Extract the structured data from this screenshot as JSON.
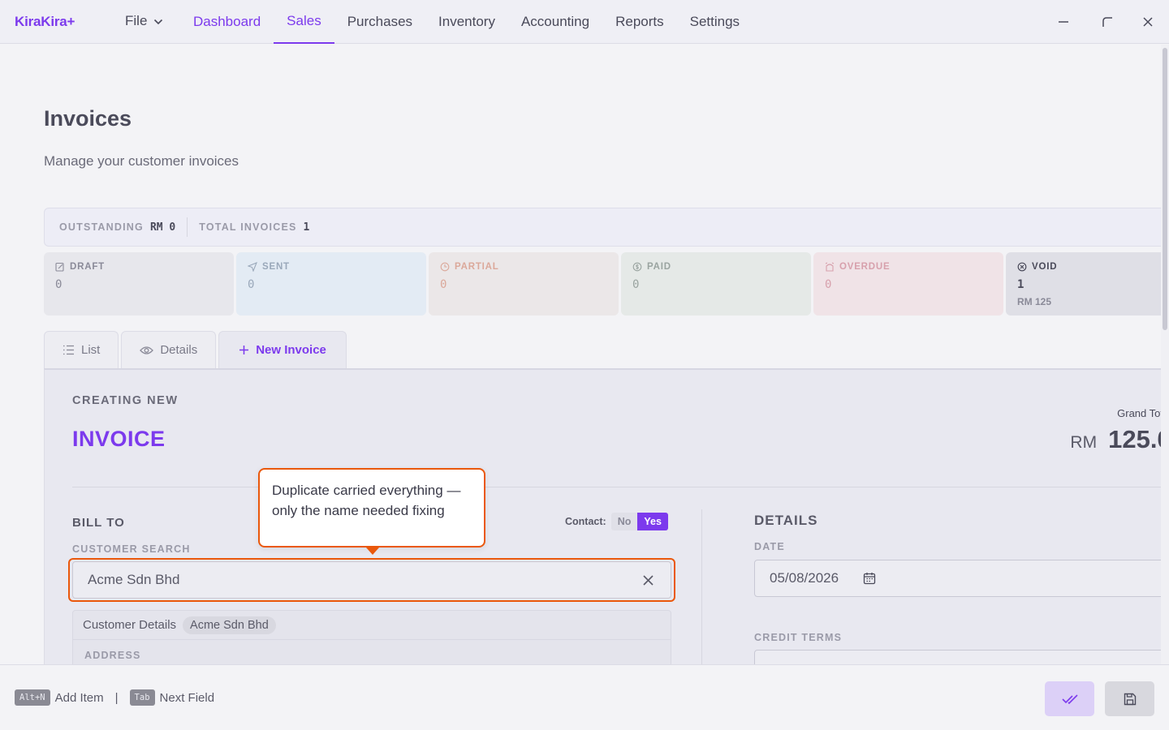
{
  "app": {
    "logo": "KiraKira+"
  },
  "menu": {
    "file_label": "File"
  },
  "nav": [
    {
      "label": "Dashboard"
    },
    {
      "label": "Sales"
    },
    {
      "label": "Purchases"
    },
    {
      "label": "Inventory"
    },
    {
      "label": "Accounting"
    },
    {
      "label": "Reports"
    },
    {
      "label": "Settings"
    }
  ],
  "page": {
    "title": "Invoices",
    "subtitle": "Manage your customer invoices"
  },
  "summary": {
    "outstanding_label": "OUTSTANDING",
    "outstanding_value": "RM 0",
    "total_label": "TOTAL INVOICES",
    "total_value": "1"
  },
  "statuses": [
    {
      "label": "DRAFT",
      "count": "0",
      "icon": "edit-icon"
    },
    {
      "label": "SENT",
      "count": "0",
      "icon": "send-icon"
    },
    {
      "label": "PARTIAL",
      "count": "0",
      "icon": "clock-icon"
    },
    {
      "label": "PAID",
      "count": "0",
      "icon": "dollar-icon"
    },
    {
      "label": "OVERDUE",
      "count": "0",
      "icon": "alarm-icon"
    },
    {
      "label": "VOID",
      "count": "1",
      "amount": "RM 125",
      "icon": "x-circle-icon"
    }
  ],
  "tabs": [
    {
      "label": "List",
      "icon": "list-icon"
    },
    {
      "label": "Details",
      "icon": "eye-icon"
    },
    {
      "label": "New Invoice",
      "icon": "plus-icon"
    }
  ],
  "form": {
    "creating_label": "CREATING NEW",
    "title": "INVOICE",
    "grand_total_label": "Grand Tot",
    "currency": "RM",
    "grand_total_value": "125.0(",
    "bill_to_label": "BILL TO",
    "contact_label": "Contact:",
    "contact_no": "No",
    "contact_yes": "Yes",
    "customer_search_label": "CUSTOMER SEARCH",
    "customer_search_value": "Acme Sdn Bhd",
    "customer_details_label": "Customer Details",
    "customer_chip": "Acme Sdn Bhd",
    "address_label": "ADDRESS",
    "details_label": "DETAILS",
    "date_label": "DATE",
    "date_value": "05/08/2026",
    "credit_terms_label": "CREDIT TERMS"
  },
  "callout": {
    "text": "Duplicate carried everything — only the name needed fixing"
  },
  "footer": {
    "hint1_key": "Alt+N",
    "hint1_label": "Add Item",
    "separator": "|",
    "hint2_key": "Tab",
    "hint2_label": "Next Field"
  },
  "colors": {
    "accent": "#7c3aed",
    "highlight": "#ea580c"
  }
}
